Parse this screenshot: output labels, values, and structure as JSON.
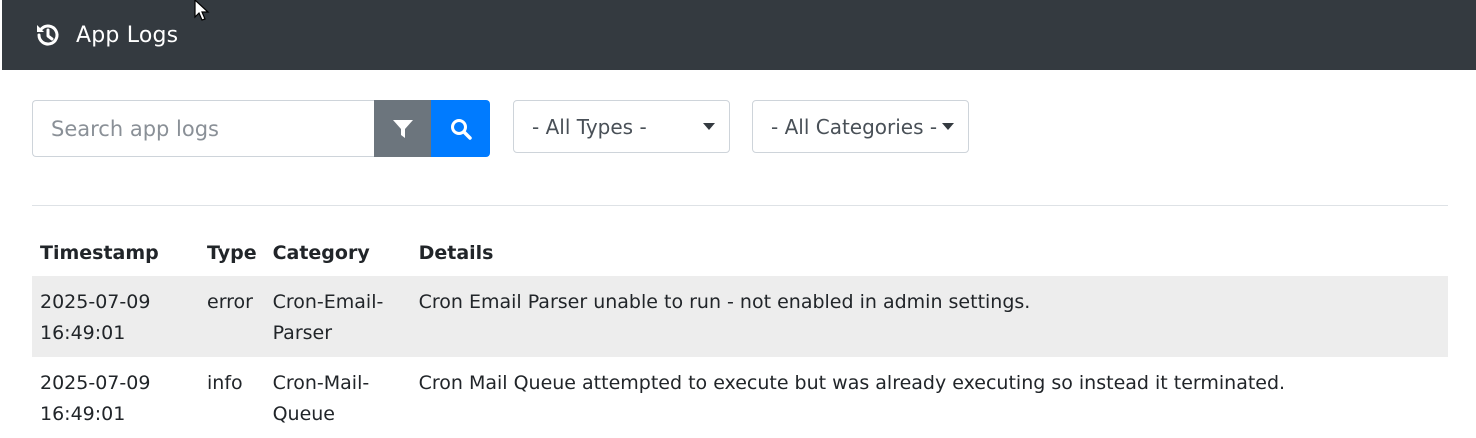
{
  "header": {
    "title": "App Logs"
  },
  "filters": {
    "search_placeholder": "Search app logs",
    "types_selected": "- All Types -",
    "categories_selected": "- All Categories -"
  },
  "table": {
    "headers": [
      "Timestamp",
      "Type",
      "Category",
      "Details"
    ],
    "rows": [
      {
        "timestamp": "2025-07-09 16:49:01",
        "type": "error",
        "category": "Cron-Email-Parser",
        "details": "Cron Email Parser unable to run - not enabled in admin settings."
      },
      {
        "timestamp": "2025-07-09 16:49:01",
        "type": "info",
        "category": "Cron-Mail-Queue",
        "details": "Cron Mail Queue attempted to execute but was already executing so instead it terminated."
      }
    ]
  },
  "colors": {
    "header_bg": "#343a40",
    "filter_button": "#6c757d",
    "search_button": "#007bff",
    "row_stripe": "#ededed"
  },
  "icons": {
    "header": "history-icon",
    "filter": "filter-icon",
    "search": "search-icon",
    "dropdown": "caret-down-icon",
    "cursor": "mouse-pointer"
  }
}
